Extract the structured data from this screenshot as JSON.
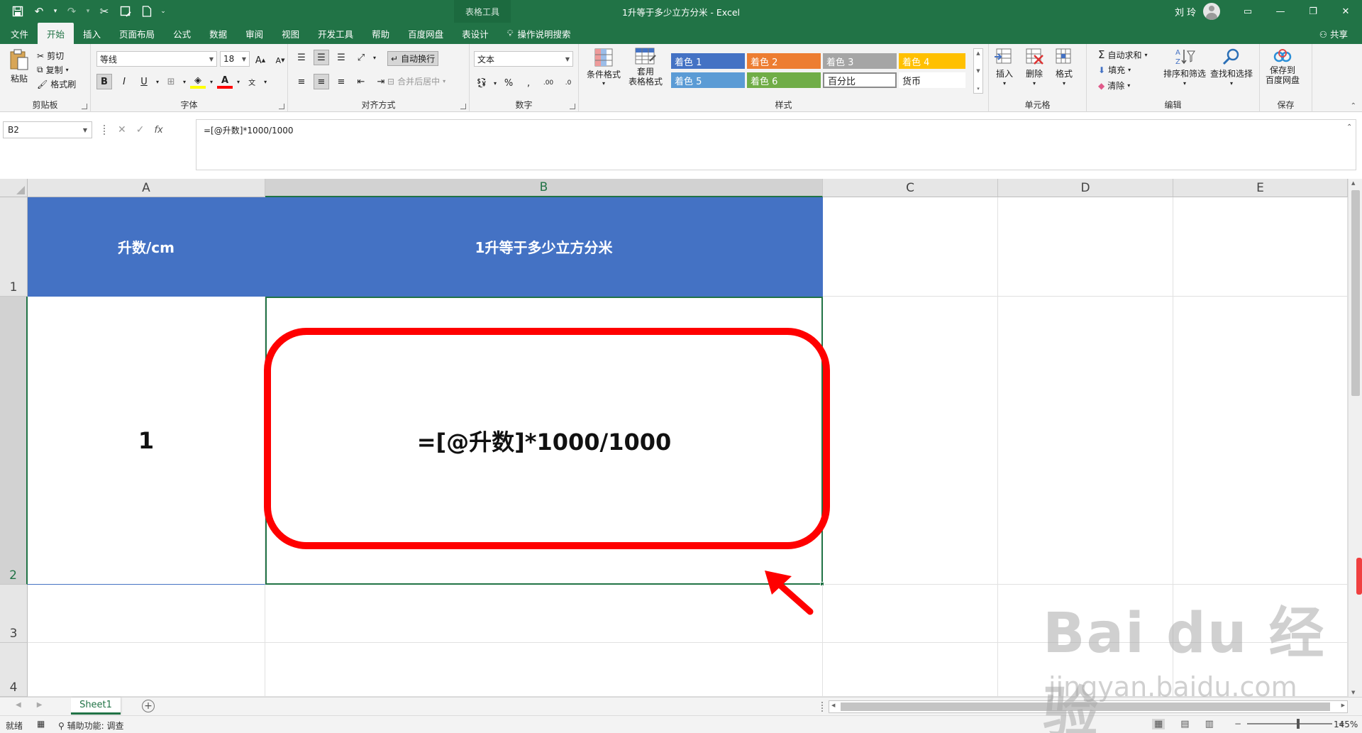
{
  "window": {
    "title": "1升等于多少立方分米  -  Excel",
    "context_tool": "表格工具",
    "user": "刘 玲"
  },
  "tabs": [
    "文件",
    "开始",
    "插入",
    "页面布局",
    "公式",
    "数据",
    "审阅",
    "视图",
    "开发工具",
    "帮助",
    "百度网盘",
    "表设计"
  ],
  "active_tab": "开始",
  "tell_me": "操作说明搜索",
  "share": "共享",
  "ribbon": {
    "clipboard": {
      "label": "剪贴板",
      "paste": "粘贴",
      "cut": "剪切",
      "copy": "复制",
      "format_painter": "格式刷"
    },
    "font": {
      "label": "字体",
      "name": "等线",
      "size": "18"
    },
    "alignment": {
      "label": "对齐方式",
      "wrap": "自动换行",
      "merge": "合并后居中"
    },
    "number": {
      "label": "数字",
      "format": "文本"
    },
    "styles": {
      "label": "样式",
      "conditional": "条件格式",
      "table_format": "套用\n表格格式",
      "cells": [
        {
          "name": "着色 1",
          "color": "#4472c4"
        },
        {
          "name": "着色 2",
          "color": "#ed7d31"
        },
        {
          "name": "着色 3",
          "color": "#a5a5a5"
        },
        {
          "name": "着色 4",
          "color": "#ffc000"
        },
        {
          "name": "着色 5",
          "color": "#5b9bd5"
        },
        {
          "name": "着色 6",
          "color": "#70ad47"
        },
        {
          "name": "百分比",
          "color": "#ffffff"
        },
        {
          "name": "货币",
          "color": "#ffffff"
        }
      ]
    },
    "cells_group": {
      "label": "单元格",
      "insert": "插入",
      "delete": "删除",
      "format": "格式"
    },
    "editing": {
      "label": "编辑",
      "autosum": "自动求和",
      "fill": "填充",
      "clear": "清除",
      "sort": "排序和筛选",
      "find": "查找和选择"
    },
    "save": {
      "label": "保存",
      "button": "保存到\n百度网盘"
    }
  },
  "formula_bar": {
    "name_box": "B2",
    "formula": "=[@升数]*1000/1000",
    "fx": "fx"
  },
  "columns": [
    "A",
    "B",
    "C",
    "D",
    "E"
  ],
  "rows": [
    "1",
    "2",
    "3",
    "4"
  ],
  "cells": {
    "A1": "升数/cm",
    "B1": "1升等于多少立方分米",
    "A2": "1",
    "B2": "=[@升数]*1000/1000"
  },
  "sheet_tab": "Sheet1",
  "status": {
    "ready": "就绪",
    "accessibility": "辅助功能: 调查",
    "zoom": "145%"
  },
  "watermark": {
    "brand": "Bai du 经验",
    "url": "jingyan.baidu.com"
  },
  "colors": {
    "excel_green": "#217346",
    "header_blue": "#4472c4",
    "highlight_red": "#ff0000"
  }
}
